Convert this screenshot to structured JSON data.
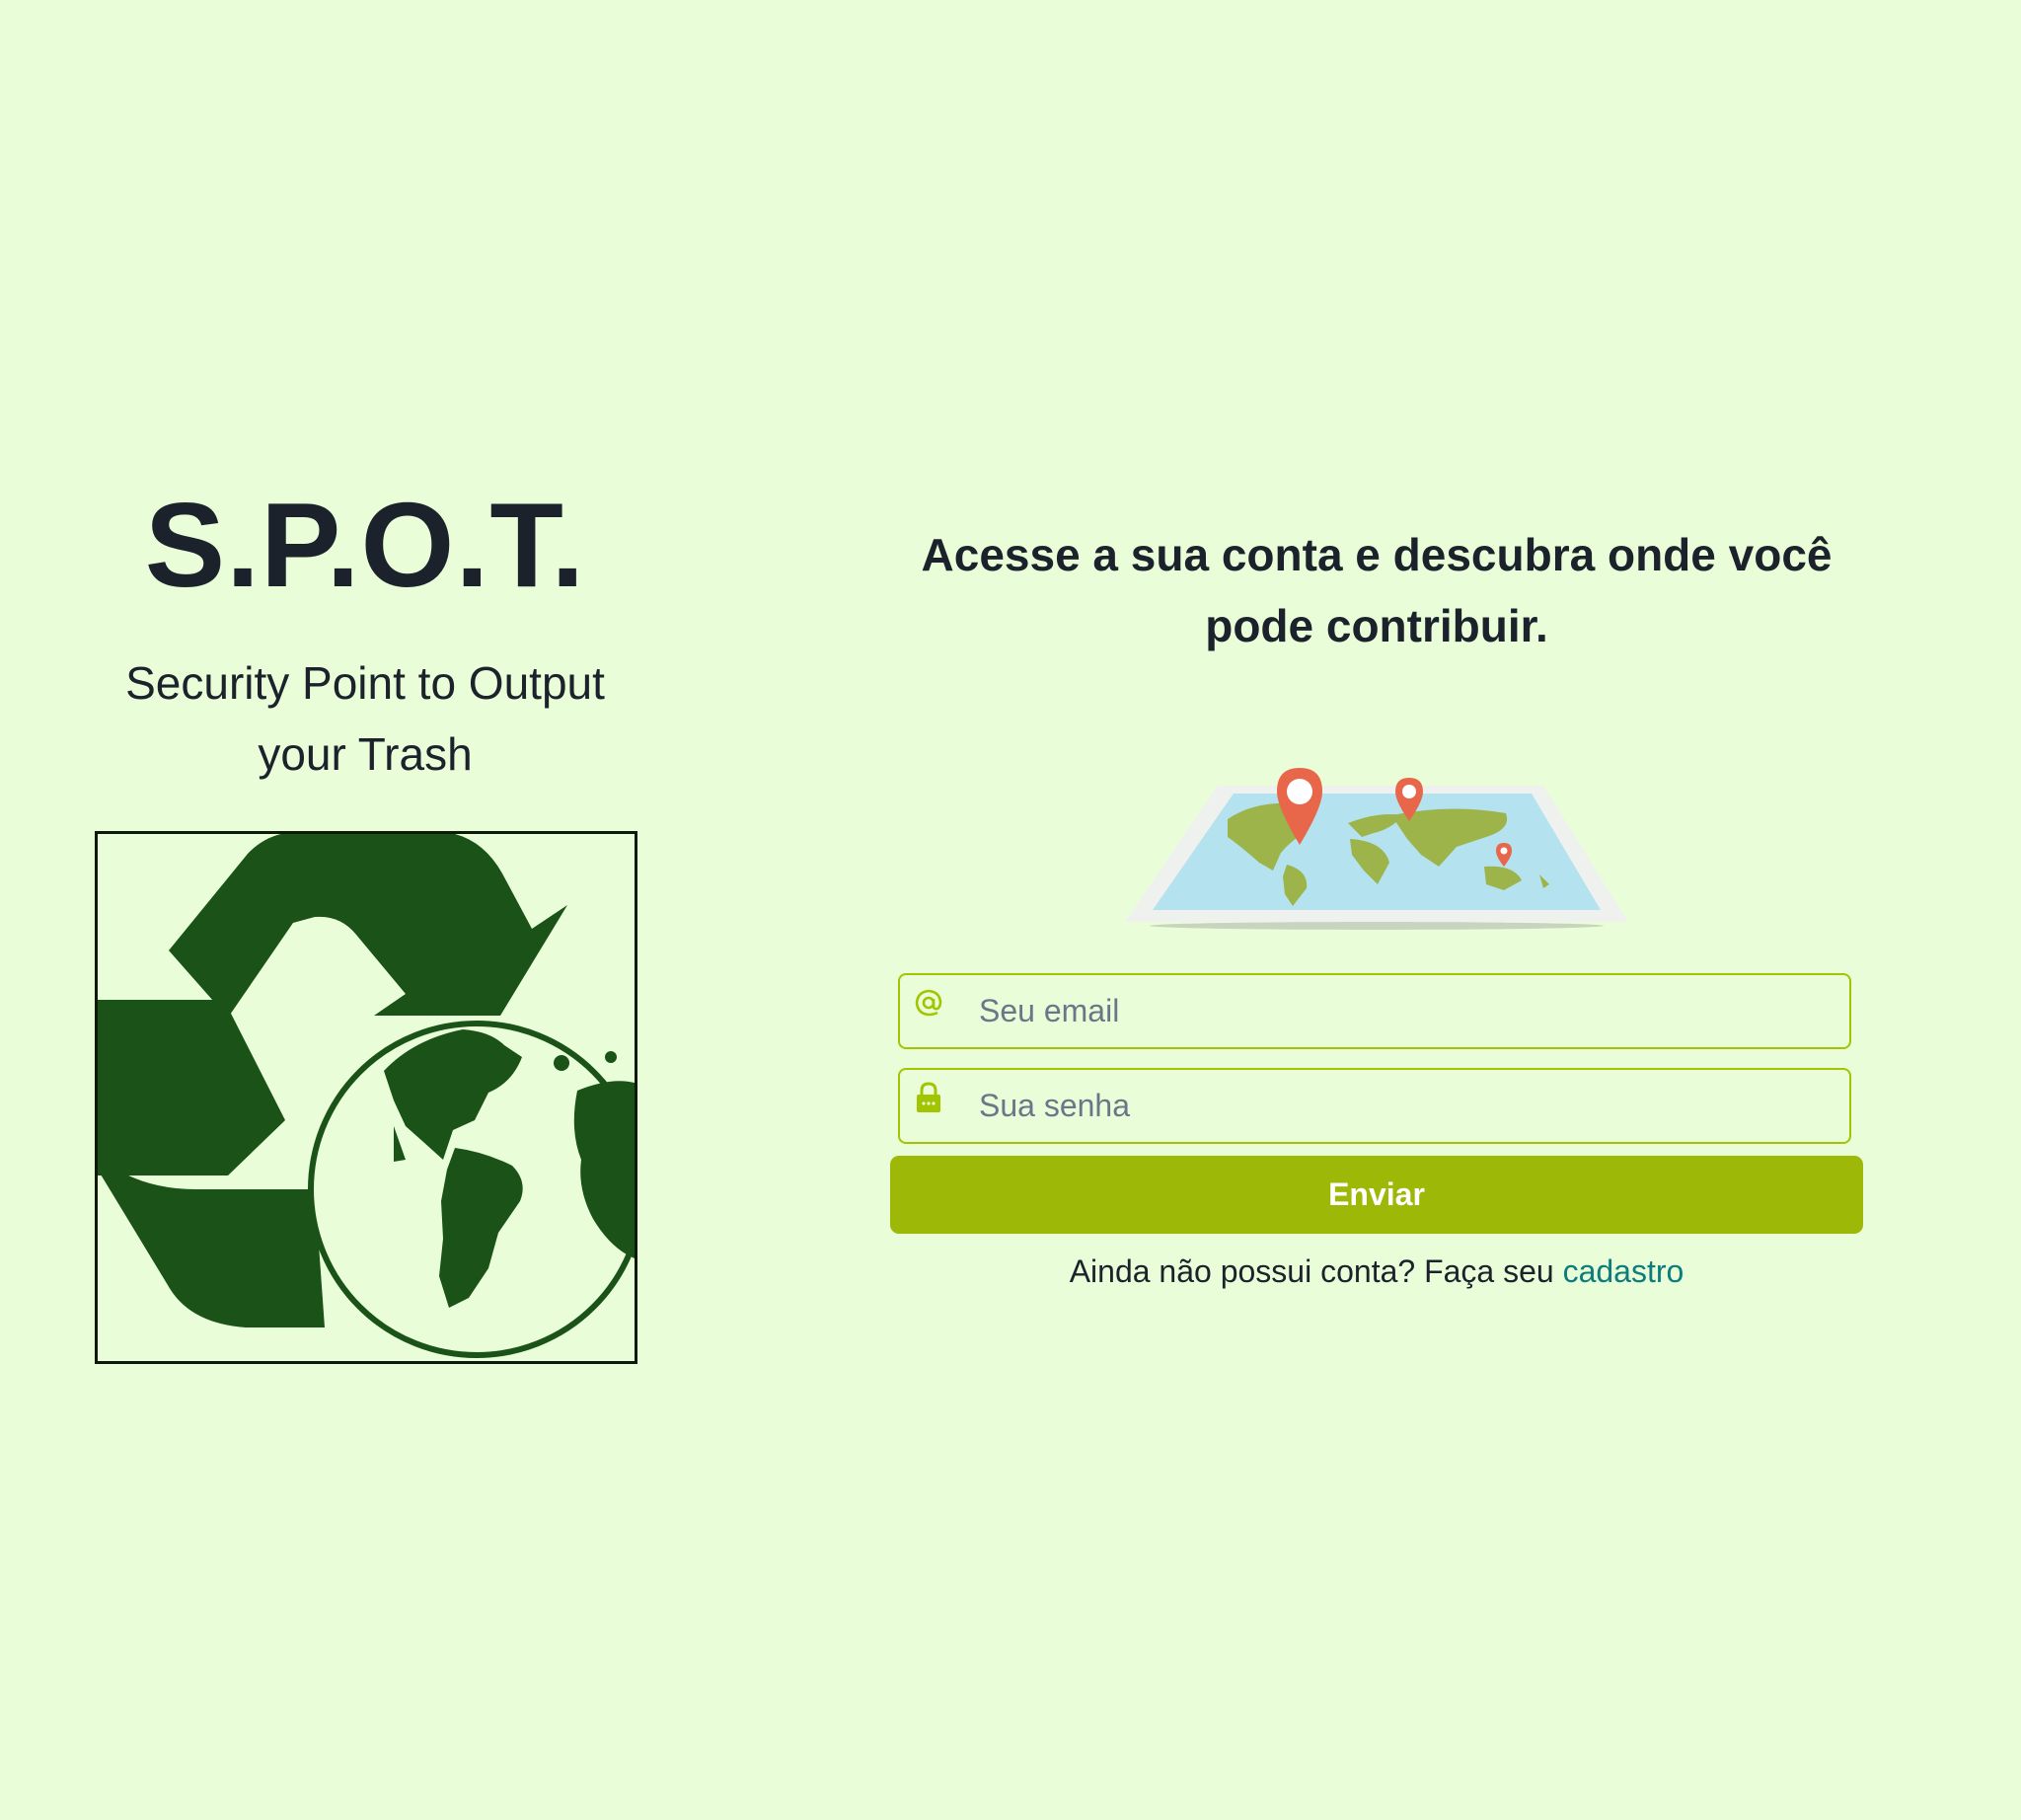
{
  "brand": {
    "title": "S.P.O.T.",
    "subtitle": "Security Point to Output your Trash",
    "logo_icon": "recycle-globe-icon"
  },
  "login": {
    "headline": "Acesse a sua conta e descubra onde você pode contribuir.",
    "illustration_icon": "world-map-pins-icon",
    "email_placeholder": "Seu email",
    "email_icon": "at-sign-icon",
    "password_placeholder": "Sua senha",
    "password_icon": "lock-icon",
    "submit_label": "Enviar",
    "signup_prompt": "Ainda não possui conta? Faça seu ",
    "signup_link": "cadastro"
  },
  "colors": {
    "background": "#e9fed8",
    "accent": "#9db807",
    "logo_green": "#1a5218",
    "link": "#0b7d7a",
    "pin": "#e8674b",
    "ocean": "#b4e3ef",
    "land": "#9db44a"
  }
}
